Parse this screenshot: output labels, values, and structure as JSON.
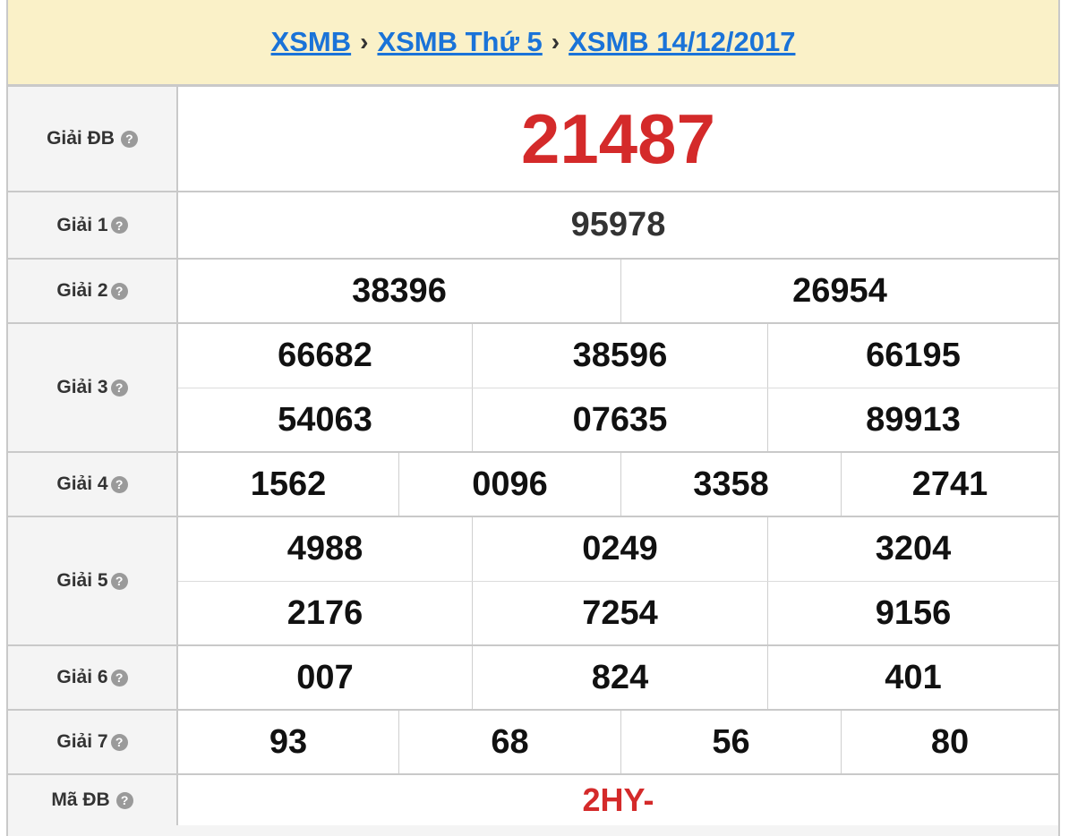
{
  "breadcrumb": {
    "items": [
      "XSMB",
      "XSMB Thứ 5",
      "XSMB 14/12/2017"
    ],
    "separator": "›"
  },
  "labels": {
    "db": "Giải ĐB",
    "g1": "Giải 1",
    "g2": "Giải 2",
    "g3": "Giải 3",
    "g4": "Giải 4",
    "g5": "Giải 5",
    "g6": "Giải 6",
    "g7": "Giải 7",
    "madb": "Mã ĐB"
  },
  "help_icon": {
    "name": "question-circle-icon",
    "glyph": "?"
  },
  "results": {
    "db": "21487",
    "g1": "95978",
    "g2": [
      "38396",
      "26954"
    ],
    "g3": [
      "66682",
      "38596",
      "66195",
      "54063",
      "07635",
      "89913"
    ],
    "g4": [
      "1562",
      "0096",
      "3358",
      "2741"
    ],
    "g5": [
      "4988",
      "0249",
      "3204",
      "2176",
      "7254",
      "9156"
    ],
    "g6": [
      "007",
      "824",
      "401"
    ],
    "g7": [
      "93",
      "68",
      "56",
      "80"
    ],
    "madb": "2HY-"
  },
  "colors": {
    "header_bg": "#faf1c8",
    "link": "#1a73d8",
    "accent_red": "#d42a2a",
    "label_bg": "#f4f4f4",
    "border": "#c9c9c9"
  }
}
